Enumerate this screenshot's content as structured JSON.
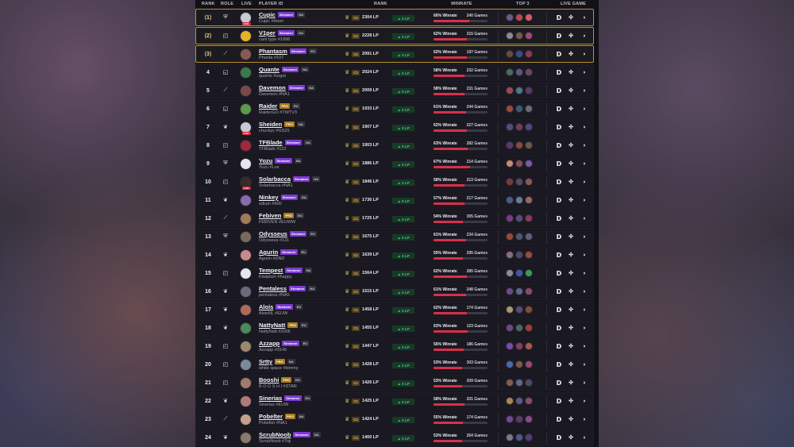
{
  "header": {
    "rank": "RANK",
    "role": "ROLE",
    "live": "LIVE",
    "player_id": "PLAYER ID",
    "rank_col": "RANK",
    "winrate": "WINRATE",
    "top3": "TOP 3",
    "live_game": "LIVE GAME"
  },
  "rows": [
    {
      "rank": "1",
      "name": "Cupic",
      "badge": "Streamer",
      "badge_type": "streamer",
      "region": "NA",
      "tag": "Cupic #Hwei",
      "lp": "2304 LP",
      "delta": "0 LP",
      "wr": "66% Winrate",
      "games": "240 Games",
      "wr_pct": 66,
      "live": true,
      "role": "support",
      "avatar": "#c9c9d6",
      "champs": [
        "#6b5a86",
        "#b84a4a",
        "#d65a6a"
      ]
    },
    {
      "rank": "2",
      "name": "V1per",
      "badge": "Streamer",
      "badge_type": "streamer",
      "region": "NA",
      "tag": "cant type #1998",
      "lp": "2228 LP",
      "delta": "0 LP",
      "wr": "62% Winrate",
      "games": "315 Games",
      "wr_pct": 62,
      "live": false,
      "role": "top",
      "avatar": "#e3b426",
      "champs": [
        "#8a8a96",
        "#7a5a4a",
        "#a04a7a"
      ]
    },
    {
      "rank": "3",
      "name": "Phantasm",
      "badge": "Streamer",
      "badge_type": "streamer",
      "region": "EU",
      "tag": "Phanta #107",
      "lp": "2091 LP",
      "delta": "0 LP",
      "wr": "62% Winrate",
      "games": "197 Games",
      "wr_pct": 62,
      "live": false,
      "role": "mid",
      "avatar": "#8a5a50",
      "champs": [
        "#6a4a3a",
        "#3a4a8a",
        "#8a3a5a"
      ]
    },
    {
      "rank": "4",
      "name": "Quante",
      "badge": "Streamer",
      "badge_type": "streamer",
      "region": "NA",
      "tag": "quante #urgot",
      "lp": "2024 LP",
      "delta": "0 LP",
      "wr": "58% Winrate",
      "games": "232 Games",
      "wr_pct": 58,
      "live": false,
      "role": "bot",
      "avatar": "#3a7a4a",
      "champs": [
        "#4a6a5a",
        "#5a5a7a",
        "#6a4a5a"
      ]
    },
    {
      "rank": "5",
      "name": "Davemon",
      "badge": "Streamer",
      "badge_type": "streamer",
      "region": "NA",
      "tag": "Davemon #NA1",
      "lp": "2009 LP",
      "delta": "0 LP",
      "wr": "58% Winrate",
      "games": "231 Games",
      "wr_pct": 58,
      "live": false,
      "role": "mid",
      "avatar": "#7a4a4a",
      "champs": [
        "#a04a4a",
        "#4a7a8a",
        "#5a3a6a"
      ]
    },
    {
      "rank": "6",
      "name": "Raider",
      "badge": "PRO",
      "badge_type": "pro",
      "region": "EU",
      "tag": "RaiderGO #TWTV3",
      "lp": "1933 LP",
      "delta": "0 LP",
      "wr": "61% Winrate",
      "games": "244 Games",
      "wr_pct": 61,
      "live": false,
      "role": "bot",
      "avatar": "#5a9a4a",
      "champs": [
        "#9a4a3a",
        "#3a5a7a",
        "#6a6a7a"
      ]
    },
    {
      "rank": "7",
      "name": "Sheiden",
      "badge": "PRO",
      "badge_type": "pro",
      "region": "NA",
      "tag": "chuckyy #GS25",
      "lp": "1907 LP",
      "delta": "0 LP",
      "wr": "62% Winrate",
      "games": "227 Games",
      "wr_pct": 62,
      "live": true,
      "role": "jungle",
      "avatar": "#c9c9d6",
      "champs": [
        "#5a4a7a",
        "#7a3a5a",
        "#4a4a8a"
      ]
    },
    {
      "rank": "8",
      "name": "TFBlade",
      "badge": "Streamer",
      "badge_type": "streamer",
      "region": "NA",
      "tag": "TFBlade #122",
      "lp": "1903 LP",
      "delta": "0 LP",
      "wr": "63% Winrate",
      "games": "282 Games",
      "wr_pct": 63,
      "live": false,
      "role": "top",
      "avatar": "#a0283a",
      "champs": [
        "#5a3a6a",
        "#8a4a3a",
        "#6a5a4a"
      ]
    },
    {
      "rank": "9",
      "name": "Yozu",
      "badge": "Streamer",
      "badge_type": "streamer",
      "region": "NA",
      "tag": "Yozu #Lux",
      "lp": "1886 LP",
      "delta": "0 LP",
      "wr": "67% Winrate",
      "games": "214 Games",
      "wr_pct": 67,
      "live": false,
      "role": "support",
      "avatar": "#e6e6ee",
      "champs": [
        "#c88a6a",
        "#8a4a5a",
        "#7a5aaa"
      ]
    },
    {
      "rank": "10",
      "name": "Solarbacca",
      "badge": "Streamer",
      "badge_type": "streamer",
      "region": "NA",
      "tag": "Solarbacca #NA1",
      "lp": "1846 LP",
      "delta": "0 LP",
      "wr": "58% Winrate",
      "games": "213 Games",
      "wr_pct": 58,
      "live": true,
      "role": "top",
      "avatar": "#3a2a2a",
      "champs": [
        "#7a3a3a",
        "#5a4a6a",
        "#8a5a4a"
      ]
    },
    {
      "rank": "11",
      "name": "Ninkey",
      "badge": "Streamer",
      "badge_type": "streamer",
      "region": "NA",
      "tag": "odium #600",
      "lp": "1736 LP",
      "delta": "0 LP",
      "wr": "57% Winrate",
      "games": "217 Games",
      "wr_pct": 57,
      "live": false,
      "role": "jungle",
      "avatar": "#8a6aaa",
      "champs": [
        "#4a5a8a",
        "#6a7a9a",
        "#9a6a5a"
      ]
    },
    {
      "rank": "12",
      "name": "Febiven",
      "badge": "PRO",
      "badge_type": "pro",
      "region": "EU",
      "tag": "FEBIVEN #EUWW",
      "lp": "1725 LP",
      "delta": "0 LP",
      "wr": "54% Winrate",
      "games": "305 Games",
      "wr_pct": 54,
      "live": false,
      "role": "mid",
      "avatar": "#a07a5a",
      "champs": [
        "#7a3a8a",
        "#5a4a7a",
        "#8a3a5a"
      ]
    },
    {
      "rank": "13",
      "name": "Odysseus",
      "badge": "Streamer",
      "badge_type": "streamer",
      "region": "EU",
      "tag": "Odysseus #131",
      "lp": "1675 LP",
      "delta": "0 LP",
      "wr": "61% Winrate",
      "games": "234 Games",
      "wr_pct": 61,
      "live": false,
      "role": "support",
      "avatar": "#7a6a5a",
      "champs": [
        "#9a4a3a",
        "#4a5a6a",
        "#6a5a7a"
      ]
    },
    {
      "rank": "14",
      "name": "Agurin",
      "badge": "Streamer",
      "badge_type": "streamer",
      "region": "EU",
      "tag": "Agurin #DND",
      "lp": "1639 LP",
      "delta": "0 LP",
      "wr": "55% Winrate",
      "games": "295 Games",
      "wr_pct": 55,
      "live": false,
      "role": "jungle",
      "avatar": "#c88a8a",
      "champs": [
        "#8a6a8a",
        "#4a4a6a",
        "#9a4a3a"
      ]
    },
    {
      "rank": "15",
      "name": "Tempest",
      "badge": "Streamer",
      "badge_type": "streamer",
      "region": "NA",
      "tag": "Kiwiplum #happy",
      "lp": "1564 LP",
      "delta": "0 LP",
      "wr": "62% Winrate",
      "games": "285 Games",
      "wr_pct": 62,
      "live": false,
      "role": "top",
      "avatar": "#e6e6ee",
      "champs": [
        "#8a8a9a",
        "#3a5aaa",
        "#3a9a5a"
      ]
    },
    {
      "rank": "16",
      "name": "Pentaless",
      "badge": "Streamer",
      "badge_type": "streamer",
      "region": "NA",
      "tag": "pentaless #NA5",
      "lp": "1515 LP",
      "delta": "0 LP",
      "wr": "61% Winrate",
      "games": "248 Games",
      "wr_pct": 61,
      "live": false,
      "role": "jungle",
      "avatar": "#6a6a7a",
      "champs": [
        "#6a4a8a",
        "#5a6a8a",
        "#8a4a6a"
      ]
    },
    {
      "rank": "17",
      "name": "Alois",
      "badge": "Streamer",
      "badge_type": "streamer",
      "region": "EU",
      "tag": "AloisNL #EUW",
      "lp": "1458 LP",
      "delta": "0 LP",
      "wr": "62% Winrate",
      "games": "174 Games",
      "wr_pct": 62,
      "live": false,
      "role": "jungle",
      "avatar": "#b06a5a",
      "champs": [
        "#aa9a6a",
        "#5a4a7a",
        "#8a4a3a"
      ]
    },
    {
      "rank": "18",
      "name": "NattyNatt",
      "badge": "PRO",
      "badge_type": "pro",
      "region": "EU",
      "tag": "NattyNatt #2005",
      "lp": "1455 LP",
      "delta": "0 LP",
      "wr": "63% Winrate",
      "games": "123 Games",
      "wr_pct": 63,
      "live": false,
      "role": "jungle",
      "avatar": "#4a8a5a",
      "champs": [
        "#6a4a8a",
        "#4a6a5a",
        "#aa3a3a"
      ]
    },
    {
      "rank": "19",
      "name": "Azzapp",
      "badge": "Streamer",
      "badge_type": "streamer",
      "region": "EU",
      "tag": "Azzapp #3145",
      "lp": "1447 LP",
      "delta": "0 LP",
      "wr": "56% Winrate",
      "games": "186 Games",
      "wr_pct": 56,
      "live": false,
      "role": "top",
      "avatar": "#9a8a6a",
      "champs": [
        "#7a4aaa",
        "#8a3a6a",
        "#aa5a4a"
      ]
    },
    {
      "rank": "20",
      "name": "Srtty",
      "badge": "PRO",
      "badge_type": "pro",
      "region": "NA",
      "tag": "white space #kimmy",
      "lp": "1428 LP",
      "delta": "0 LP",
      "wr": "53% Winrate",
      "games": "303 Games",
      "wr_pct": 53,
      "live": false,
      "role": "top",
      "avatar": "#7a8a9a",
      "champs": [
        "#4a6aaa",
        "#7a5a4a",
        "#9a4a6a"
      ]
    },
    {
      "rank": "21",
      "name": "Booshi",
      "badge": "PRO",
      "badge_type": "pro",
      "region": "EU",
      "tag": "B O O S H I #STAR",
      "lp": "1426 LP",
      "delta": "0 LP",
      "wr": "53% Winrate",
      "games": "209 Games",
      "wr_pct": 53,
      "live": false,
      "role": "top",
      "avatar": "#a07a6a",
      "champs": [
        "#8a5a4a",
        "#5a6a8a",
        "#4a4a6a"
      ]
    },
    {
      "rank": "22",
      "name": "Sinerias",
      "badge": "Streamer",
      "badge_type": "streamer",
      "region": "EU",
      "tag": "Sinerias #EUW",
      "lp": "1425 LP",
      "delta": "0 LP",
      "wr": "58% Winrate",
      "games": "201 Games",
      "wr_pct": 58,
      "live": false,
      "role": "jungle",
      "avatar": "#b07a7a",
      "champs": [
        "#aa8a4a",
        "#5a5a8a",
        "#8a4a6a"
      ]
    },
    {
      "rank": "23",
      "name": "Pobelter",
      "badge": "PRO",
      "badge_type": "pro",
      "region": "NA",
      "tag": "Pobelter #NA1",
      "lp": "1424 LP",
      "delta": "0 LP",
      "wr": "55% Winrate",
      "games": "174 Games",
      "wr_pct": 55,
      "live": false,
      "role": "mid",
      "avatar": "#c8a08a",
      "champs": [
        "#6a4a9a",
        "#5a3a6a",
        "#8a4a8a"
      ]
    },
    {
      "rank": "24",
      "name": "ScrubNoob",
      "badge": "Streamer",
      "badge_type": "streamer",
      "region": "NA",
      "tag": "ScrubNoob #Toji",
      "lp": "1400 LP",
      "delta": "0 LP",
      "wr": "53% Winrate",
      "games": "264 Games",
      "wr_pct": 53,
      "live": false,
      "role": "jungle",
      "avatar": "#8a7a6a",
      "champs": [
        "#7a7a8a",
        "#4a5a8a",
        "#5a3a7a"
      ]
    }
  ],
  "tier_label": "C1",
  "live_badge": "LIVE",
  "colors": {
    "accent_gold": "#b8932f",
    "streamer": "#7b3ad1",
    "pro": "#a87a1c",
    "win_bar": "#d8304a",
    "lp_green": "#3fd07b"
  },
  "icons": {
    "role_support": "support-role-icon",
    "role_top": "top-role-icon",
    "role_mid": "mid-role-icon",
    "role_bot": "bot-role-icon",
    "role_jungle": "jungle-role-icon",
    "rank": "master-rank-icon",
    "live_d": "d-icon",
    "live_x": "cross-icon",
    "live_b": "bubble-icon"
  }
}
